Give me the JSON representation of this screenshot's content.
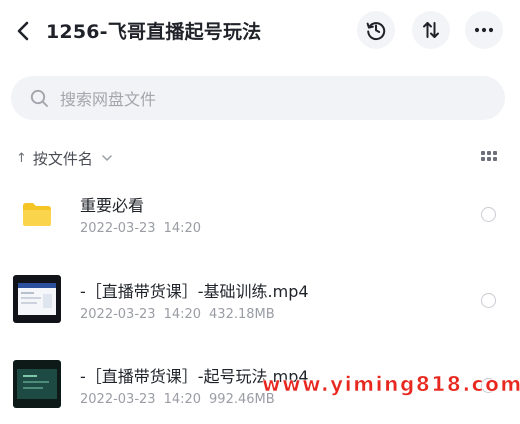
{
  "header": {
    "title": "1256-飞哥直播起号玩法",
    "icons": [
      "back-icon",
      "history-icon",
      "sort-icon",
      "more-icon"
    ]
  },
  "search": {
    "placeholder": "搜索网盘文件"
  },
  "sortbar": {
    "arrow": "↑",
    "label": "按文件名"
  },
  "files": [
    {
      "name": "重要必看",
      "date": "2022-03-23",
      "time": "14:20",
      "size": "",
      "type": "folder"
    },
    {
      "name": "-［直播带货课］-基础训练.mp4",
      "date": "2022-03-23",
      "time": "14:20",
      "size": "432.18MB",
      "type": "video"
    },
    {
      "name": "-［直播带货课］-起号玩法.mp4",
      "date": "2022-03-23",
      "time": "14:20",
      "size": "992.46MB",
      "type": "video"
    }
  ],
  "watermark": "www.yiming818.com",
  "colors": {
    "folder": "#f5c425",
    "watermark": "#e8281f",
    "search_bg": "#f2f3f6"
  }
}
